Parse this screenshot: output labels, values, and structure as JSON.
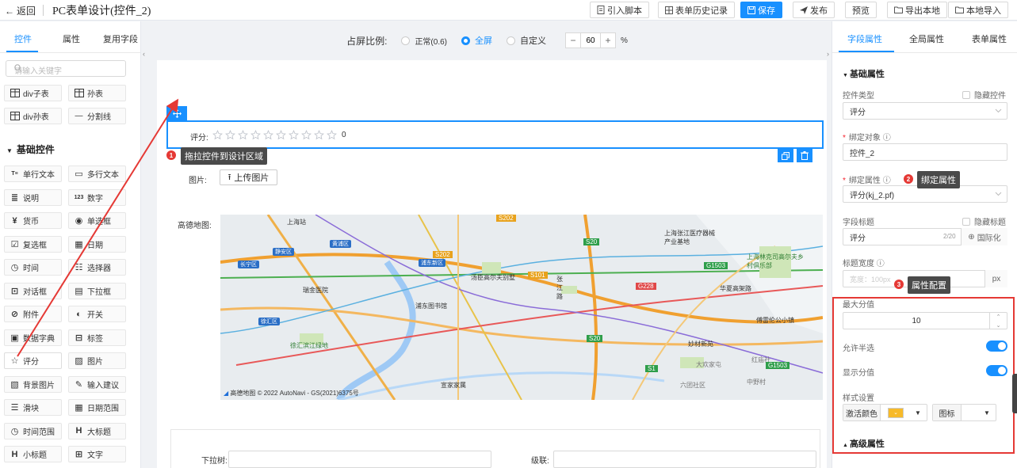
{
  "topbar": {
    "back_label": "返回",
    "title": "PC表单设计(控件_2)",
    "buttons": {
      "import_script": "引入脚本",
      "history": "表单历史记录",
      "save": "保存",
      "publish": "发布",
      "preview": "预览",
      "export_local": "导出本地",
      "import_local": "本地导入"
    }
  },
  "left_panel": {
    "tabs": [
      "控件",
      "属性",
      "复用字段"
    ],
    "search_placeholder": "请输入关键字",
    "top_controls": [
      "div子表",
      "孙表",
      "div孙表",
      "分割线"
    ],
    "section_title": "基础控件",
    "controls": [
      "单行文本",
      "多行文本",
      "说明",
      "数字",
      "货币",
      "单选框",
      "复选框",
      "日期",
      "时间",
      "选择器",
      "对话框",
      "下拉框",
      "附件",
      "开关",
      "数据字典",
      "标签",
      "评分",
      "图片",
      "背景图片",
      "输入建议",
      "滑块",
      "日期范围",
      "时间范围",
      "大标题",
      "小标题",
      "文字"
    ]
  },
  "center": {
    "ratio": {
      "label": "占屏比例:",
      "options": [
        "正常(0.6)",
        "全屏",
        "自定义"
      ],
      "selected": "全屏",
      "minus": "−",
      "plus": "+",
      "value": "60",
      "unit": "%"
    },
    "rating_label": "评分:",
    "rating_star_count": 10,
    "rating_value": "0",
    "image_label": "图片:",
    "upload_label": "上传图片",
    "map_label": "高德地图:",
    "map": {
      "labels": [
        "上海站",
        "静安区",
        "长宁区",
        "黄浦区",
        "浦东新区",
        "瑞金医院",
        "徐汇区",
        "汤臣高尔夫别墅",
        "浦东图书馆",
        "张江路",
        "上海张江医疗器械产业基地",
        "上海林克司高尔夫乡村俱乐部",
        "华夏高架路",
        "徐汇滨江绿地",
        "妙材新苑",
        "傅雷伦公小镇",
        "宣家家属",
        "六团社区",
        "大欢家屯",
        "中野村",
        "红庙社"
      ],
      "roads": [
        "S202",
        "S202",
        "S20",
        "S101",
        "S1",
        "G1503",
        "G228",
        "S20",
        "G1503"
      ],
      "attribution": "高德地图 © 2022 AutoNavi - GS(2021)6375号"
    },
    "dropdown_label": "下拉树:",
    "cascade_label": "级联:"
  },
  "annotations": [
    {
      "num": "1",
      "text": "拖拉控件到设计区域"
    },
    {
      "num": "2",
      "text": "绑定属性"
    },
    {
      "num": "3",
      "text": "属性配置"
    }
  ],
  "right_panel": {
    "tabs": [
      "字段属性",
      "全局属性",
      "表单属性"
    ],
    "basic_section": "基础属性",
    "control_type_label": "控件类型",
    "hide_control_label": "隐藏控件",
    "control_type_value": "评分",
    "bind_object_label": "绑定对象",
    "bind_object_value": "控件_2",
    "bind_attr_label": "绑定属性",
    "bind_attr_value": "评分(kj_2.pf)",
    "field_title_label": "字段标题",
    "hide_title_label": "隐藏标题",
    "field_title_value": "评分",
    "field_title_count": "2/20",
    "i18n_label": "国际化",
    "title_width_label": "标题宽度",
    "title_width_placeholder": "宽度：100px",
    "title_width_unit": "px",
    "max_score_label": "最大分值",
    "max_score_value": "10",
    "half_label": "允许半选",
    "half_on": true,
    "show_score_label": "显示分值",
    "show_score_on": true,
    "style_label": "样式设置",
    "active_color_label": "激活颜色",
    "active_color": "#f7ba2a",
    "icon_label": "图标",
    "advanced_section": "高级属性"
  }
}
